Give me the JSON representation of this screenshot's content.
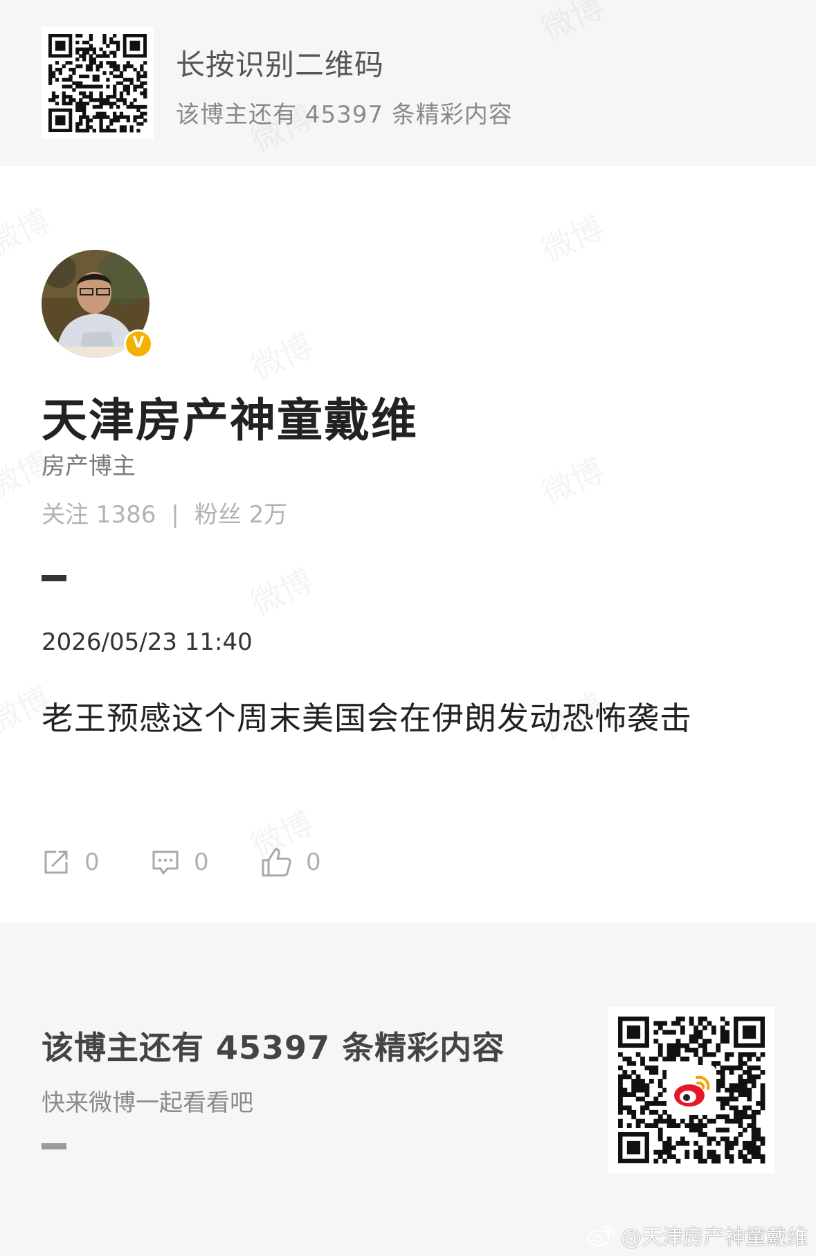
{
  "banner": {
    "title": "长按识别二维码",
    "subtitle": "该博主还有 45397 条精彩内容"
  },
  "profile": {
    "name": "天津房产神童戴维",
    "bio": "房产博主",
    "following_label": "关注 1386",
    "stats_separator": "|",
    "followers_label": "粉丝 2万",
    "verified_mark": "V"
  },
  "post": {
    "timestamp": "2026/05/23 11:40",
    "text": "老王预感这个周末美国会在伊朗发动恐怖袭击",
    "repost_count": "0",
    "comment_count": "0",
    "like_count": "0"
  },
  "footer": {
    "title": "该博主还有 45397 条精彩内容",
    "subtitle": "快来微博一起看看吧"
  },
  "watermark_text": "微博",
  "credit": "@天津房产神童戴维",
  "icons": {
    "repost": "share-icon",
    "comment": "comment-icon",
    "like": "thumbs-up-icon",
    "brand": "weibo-logo-icon"
  },
  "colors": {
    "verified": "#f5b100",
    "weibo_red": "#e6162d",
    "background": "#f6f6f6"
  }
}
